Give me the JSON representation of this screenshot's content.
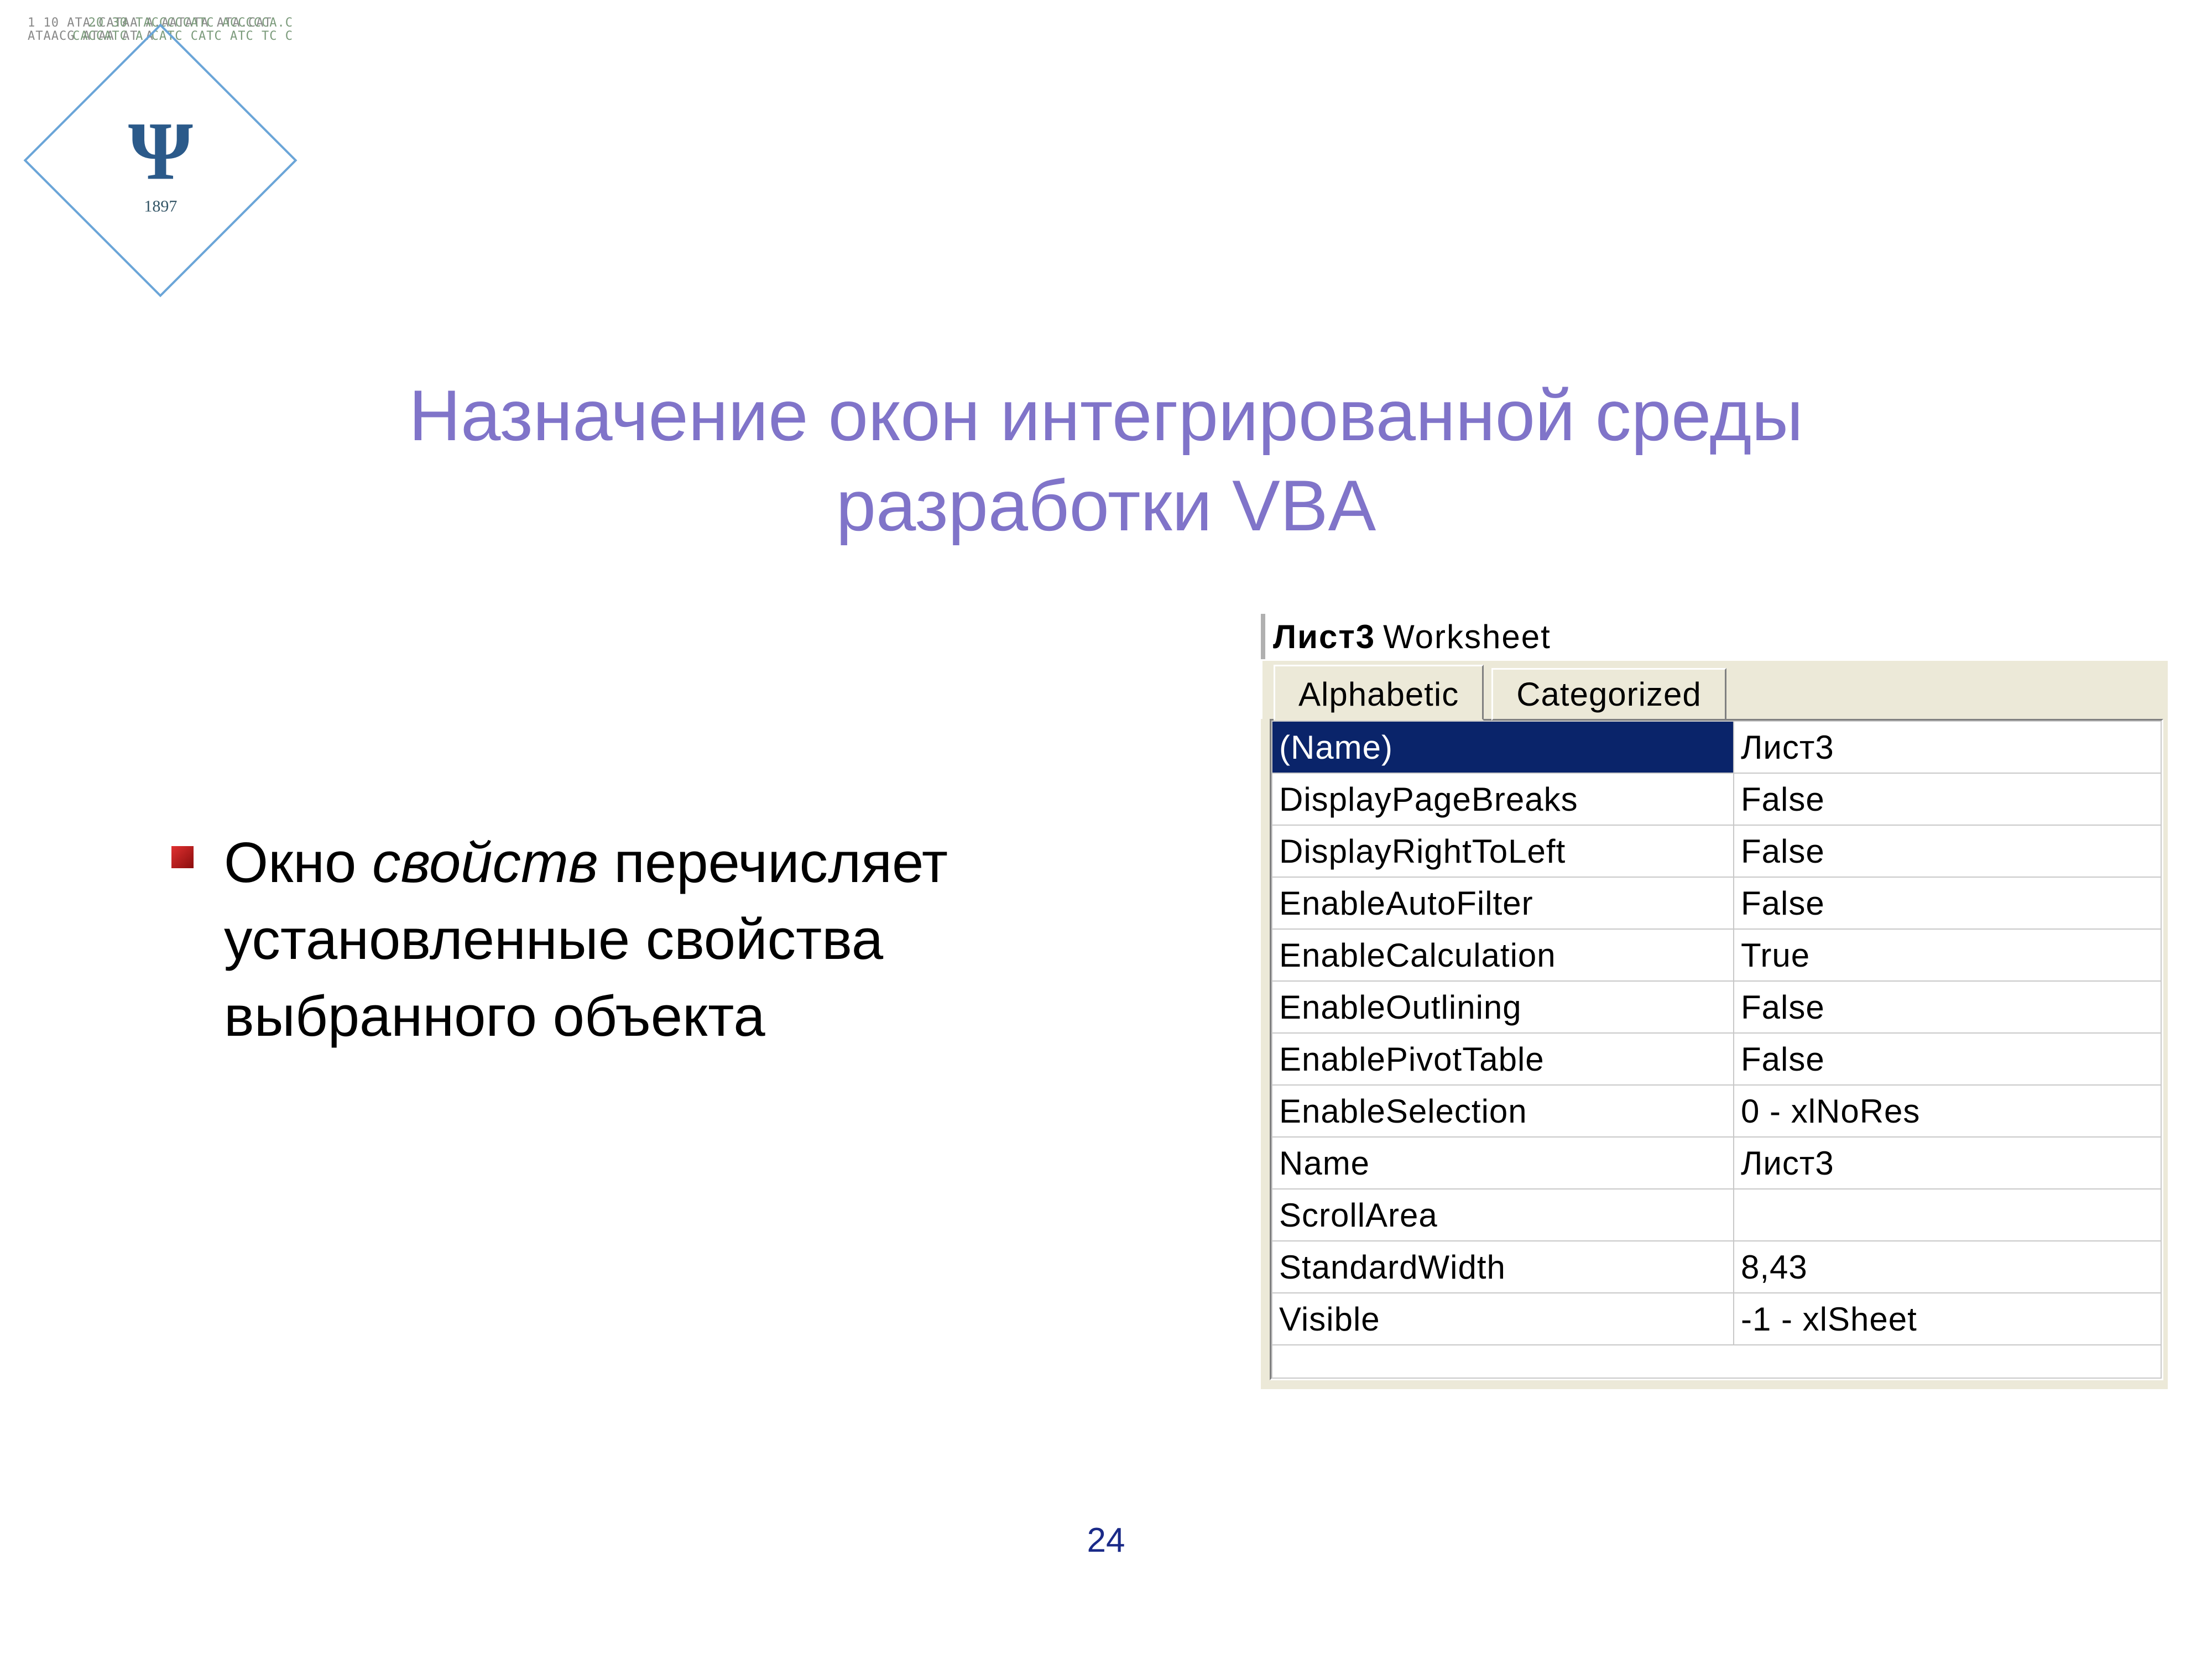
{
  "logo": {
    "left_codes": "1      10\nATA.CATAA\nA.AATATA\nATA.CAT\nATAACG\nATAA\nAT\nA",
    "right_codes": "20      30\nTACCCCCATC\nACCCCCA.C\nCACCATC\nA.CATC\nCATC\nATC\nTC\nC",
    "center_glyph": "Ψ",
    "year": "1897"
  },
  "title_line1": "Назначение окон интегрированной среды",
  "title_line2": "разработки VBA",
  "body": {
    "prefix": "Окно ",
    "italic": "свойств",
    "rest": " перечисляет установленные свойства выбранного объекта"
  },
  "props_window": {
    "object_name": "Лист3",
    "object_type": "Worksheet",
    "tabs": {
      "alphabetic": "Alphabetic",
      "categorized": "Categorized"
    },
    "rows": [
      {
        "name": "(Name)",
        "value": "Лист3",
        "selected": true
      },
      {
        "name": "DisplayPageBreaks",
        "value": "False",
        "selected": false
      },
      {
        "name": "DisplayRightToLeft",
        "value": "False",
        "selected": false
      },
      {
        "name": "EnableAutoFilter",
        "value": "False",
        "selected": false
      },
      {
        "name": "EnableCalculation",
        "value": "True",
        "selected": false
      },
      {
        "name": "EnableOutlining",
        "value": "False",
        "selected": false
      },
      {
        "name": "EnablePivotTable",
        "value": "False",
        "selected": false
      },
      {
        "name": "EnableSelection",
        "value": "0 - xlNoRes",
        "selected": false
      },
      {
        "name": "Name",
        "value": "Лист3",
        "selected": false
      },
      {
        "name": "ScrollArea",
        "value": "",
        "selected": false
      },
      {
        "name": "StandardWidth",
        "value": "8,43",
        "selected": false
      },
      {
        "name": "Visible",
        "value": "-1 - xlSheet",
        "selected": false
      }
    ]
  },
  "page_number": "24"
}
